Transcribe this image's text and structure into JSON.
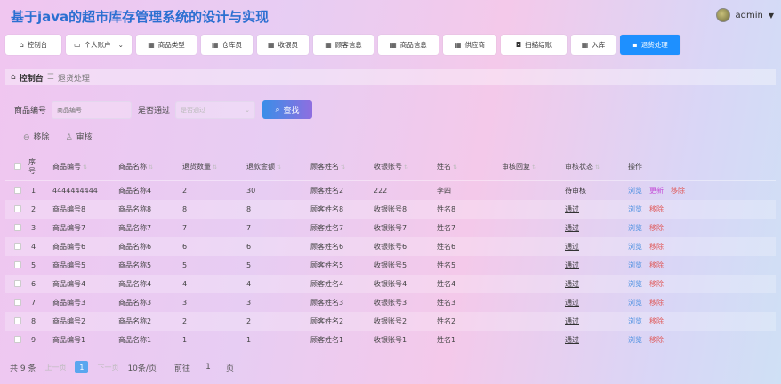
{
  "header": {
    "title": "基于java的超市库存管理系统的设计与实现",
    "user": "admin"
  },
  "nav": [
    {
      "label": "控制台",
      "icon": "home-icon",
      "active": false
    },
    {
      "label": "个人账户",
      "icon": "user-card-icon",
      "active": false
    },
    {
      "label": "商品类型",
      "icon": "grid-icon",
      "active": false
    },
    {
      "label": "仓库员",
      "icon": "grid-icon",
      "active": false
    },
    {
      "label": "收银员",
      "icon": "grid-icon",
      "active": false
    },
    {
      "label": "顾客信息",
      "icon": "grid-icon",
      "active": false
    },
    {
      "label": "商品信息",
      "icon": "grid-icon",
      "active": false
    },
    {
      "label": "供应商",
      "icon": "grid-icon",
      "active": false
    },
    {
      "label": "扫描结账",
      "icon": "briefcase-icon",
      "active": false
    },
    {
      "label": "入库",
      "icon": "grid-icon",
      "active": false
    },
    {
      "label": "退货处理",
      "icon": "chat-icon",
      "active": true
    }
  ],
  "breadcrumb": {
    "home": "控制台",
    "current": "退货处理"
  },
  "search": {
    "code_label": "商品编号",
    "code_placeholder": "商品编号",
    "pass_label": "是否通过",
    "pass_placeholder": "是否通过",
    "button": "查找"
  },
  "actions": {
    "remove": "移除",
    "audit": "审核"
  },
  "table": {
    "headers": [
      "序号",
      "商品编号",
      "商品名称",
      "退货数量",
      "退款金额",
      "顾客姓名",
      "收银账号",
      "姓名",
      "审核回复",
      "审核状态",
      "操作"
    ],
    "rows": [
      {
        "no": "1",
        "code": "4444444444",
        "name": "商品名称4",
        "qty": "2",
        "amount": "30",
        "customer": "顾客姓名2",
        "cashier": "222",
        "person": "李四",
        "reply": "",
        "status": "待审核",
        "ops": [
          "浏览",
          "更新",
          "移除"
        ]
      },
      {
        "no": "2",
        "code": "商品编号8",
        "name": "商品名称8",
        "qty": "8",
        "amount": "8",
        "customer": "顾客姓名8",
        "cashier": "收银账号8",
        "person": "姓名8",
        "reply": "",
        "status": "通过",
        "ops": [
          "浏览",
          "移除"
        ]
      },
      {
        "no": "3",
        "code": "商品编号7",
        "name": "商品名称7",
        "qty": "7",
        "amount": "7",
        "customer": "顾客姓名7",
        "cashier": "收银账号7",
        "person": "姓名7",
        "reply": "",
        "status": "通过",
        "ops": [
          "浏览",
          "移除"
        ]
      },
      {
        "no": "4",
        "code": "商品编号6",
        "name": "商品名称6",
        "qty": "6",
        "amount": "6",
        "customer": "顾客姓名6",
        "cashier": "收银账号6",
        "person": "姓名6",
        "reply": "",
        "status": "通过",
        "ops": [
          "浏览",
          "移除"
        ]
      },
      {
        "no": "5",
        "code": "商品编号5",
        "name": "商品名称5",
        "qty": "5",
        "amount": "5",
        "customer": "顾客姓名5",
        "cashier": "收银账号5",
        "person": "姓名5",
        "reply": "",
        "status": "通过",
        "ops": [
          "浏览",
          "移除"
        ]
      },
      {
        "no": "6",
        "code": "商品编号4",
        "name": "商品名称4",
        "qty": "4",
        "amount": "4",
        "customer": "顾客姓名4",
        "cashier": "收银账号4",
        "person": "姓名4",
        "reply": "",
        "status": "通过",
        "ops": [
          "浏览",
          "移除"
        ]
      },
      {
        "no": "7",
        "code": "商品编号3",
        "name": "商品名称3",
        "qty": "3",
        "amount": "3",
        "customer": "顾客姓名3",
        "cashier": "收银账号3",
        "person": "姓名3",
        "reply": "",
        "status": "通过",
        "ops": [
          "浏览",
          "移除"
        ]
      },
      {
        "no": "8",
        "code": "商品编号2",
        "name": "商品名称2",
        "qty": "2",
        "amount": "2",
        "customer": "顾客姓名2",
        "cashier": "收银账号2",
        "person": "姓名2",
        "reply": "",
        "status": "通过",
        "ops": [
          "浏览",
          "移除"
        ]
      },
      {
        "no": "9",
        "code": "商品编号1",
        "name": "商品名称1",
        "qty": "1",
        "amount": "1",
        "customer": "顾客姓名1",
        "cashier": "收银账号1",
        "person": "姓名1",
        "reply": "",
        "status": "通过",
        "ops": [
          "浏览",
          "移除"
        ]
      }
    ]
  },
  "pager": {
    "total": "共 9 条",
    "prev": "上一页",
    "page": "1",
    "next": "下一页",
    "size": "10条/页",
    "goto_label": "前往",
    "goto_value": "1",
    "goto_unit": "页"
  }
}
